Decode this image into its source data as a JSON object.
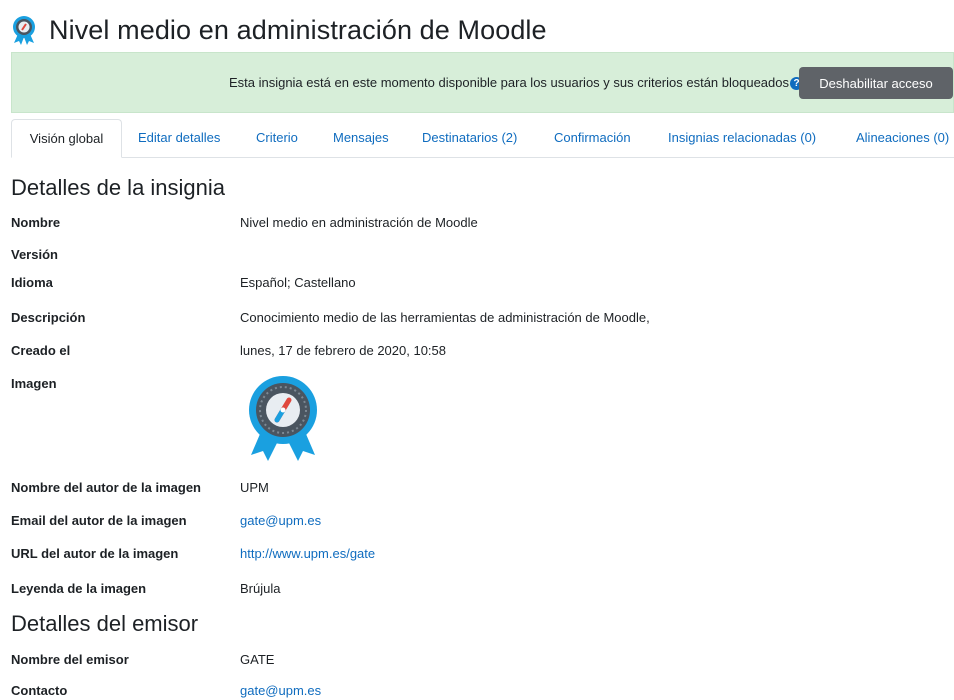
{
  "page": {
    "title": "Nivel medio en administración de Moodle"
  },
  "alert": {
    "message": "Esta insignia está en este momento disponible para los usuarios y sus criterios están bloqueados",
    "help_icon": "question-circle-icon",
    "button_label": "Deshabilitar acceso"
  },
  "tabs": [
    {
      "label": "Visión global",
      "active": true
    },
    {
      "label": "Editar detalles"
    },
    {
      "label": "Criterio"
    },
    {
      "label": "Mensajes"
    },
    {
      "label": "Destinatarios (2)"
    },
    {
      "label": "Confirmación"
    },
    {
      "label": "Insignias relacionadas (0)"
    },
    {
      "label": "Alineaciones (0)"
    }
  ],
  "badge_details": {
    "heading": "Detalles de la insignia",
    "name": {
      "label": "Nombre",
      "value": "Nivel medio en administración de Moodle"
    },
    "version": {
      "label": "Versión",
      "value": ""
    },
    "language": {
      "label": "Idioma",
      "value": "Español; Castellano"
    },
    "description": {
      "label": "Descripción",
      "value": "Conocimiento medio de las herramientas de administración de Moodle,"
    },
    "created": {
      "label": "Creado el",
      "value": "lunes, 17 de febrero de 2020, 10:58"
    },
    "image": {
      "label": "Imagen",
      "icon": "compass-badge-icon"
    },
    "image_author_name": {
      "label": "Nombre del autor de la imagen",
      "value": "UPM"
    },
    "image_author_email": {
      "label": "Email del autor de la imagen",
      "value": "gate@upm.es"
    },
    "image_author_url": {
      "label": "URL del autor de la imagen",
      "value": "http://www.upm.es/gate"
    },
    "image_caption": {
      "label": "Leyenda de la imagen",
      "value": "Brújula"
    }
  },
  "issuer_details": {
    "heading": "Detalles del emisor",
    "issuer_name": {
      "label": "Nombre del emisor",
      "value": "GATE"
    },
    "contact": {
      "label": "Contacto",
      "value": "gate@upm.es"
    }
  },
  "colors": {
    "link": "#0f6cbf",
    "alert_bg": "#d7eed9",
    "button_bg": "#5f6368",
    "badge_blue": "#1aa0e0"
  }
}
